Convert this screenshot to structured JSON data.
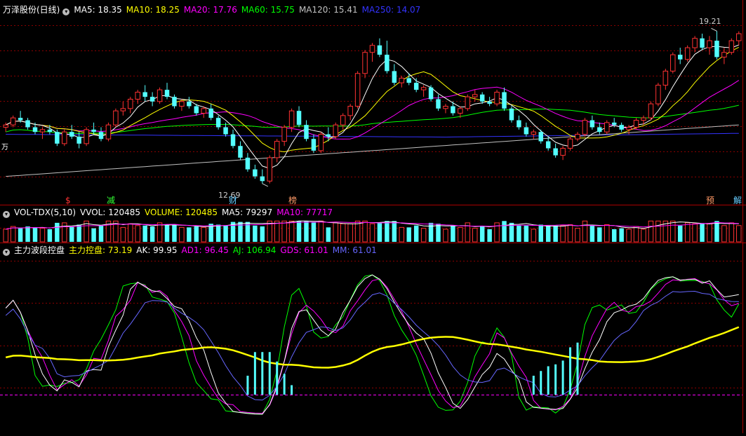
{
  "price_panel": {
    "title": "万泽股份(日线)",
    "ma5": "MA5: 18.35",
    "ma10": "MA10: 18.25",
    "ma20": "MA20: 17.76",
    "ma60": "MA60: 15.75",
    "ma120": "MA120: 15.41",
    "ma250": "MA250: 14.07",
    "high_label": "19.21",
    "low_label": "12.69",
    "left_marker": "万",
    "events": [
      {
        "label": "$",
        "color": "#ff3333"
      },
      {
        "label": "减",
        "color": "#33ff33"
      },
      {
        "label": "财",
        "color": "#66ccff"
      },
      {
        "label": "榜",
        "color": "#ff9966"
      },
      {
        "label": "预",
        "color": "#ff9966"
      },
      {
        "label": "解",
        "color": "#66ccff"
      }
    ]
  },
  "volume_panel": {
    "title": "VOL-TDX(5,10)",
    "vvol": "VVOL: 120485",
    "volume": "VOLUME: 120485",
    "ma5": "MA5: 79297",
    "ma10": "MA10: 77717"
  },
  "indicator_panel": {
    "title": "主力波段控盘",
    "main_label": "主力控盘: 73.19",
    "ak": "AK: 99.95",
    "ad1": "AD1: 96.45",
    "aj": "AJ: 106.94",
    "gds": "GDS: 61.01",
    "mm": "MM: 61.01"
  },
  "colors": {
    "up": "#ff3232",
    "down": "#54ffff",
    "ma5": "#ffffff",
    "ma10": "#ffff00",
    "ma20": "#ff00ff",
    "ma60": "#00ff00",
    "ma120": "#c0c0c0",
    "ma250": "#3333ff",
    "grid": "#8b0000"
  },
  "chart_data": {
    "type": "candlestick",
    "price_range": [
      12.0,
      20.0
    ],
    "candles": [
      [
        15.1,
        15.3,
        14.9,
        15.2
      ],
      [
        15.2,
        15.6,
        15.1,
        15.5
      ],
      [
        15.5,
        15.8,
        15.3,
        15.4
      ],
      [
        15.4,
        15.5,
        15.0,
        15.1
      ],
      [
        15.1,
        15.3,
        14.8,
        14.9
      ],
      [
        14.9,
        15.1,
        14.6,
        15.0
      ],
      [
        15.0,
        15.2,
        14.8,
        14.9
      ],
      [
        14.9,
        15.0,
        14.3,
        14.4
      ],
      [
        14.4,
        15.0,
        14.3,
        14.9
      ],
      [
        14.9,
        15.2,
        14.6,
        14.7
      ],
      [
        14.7,
        14.9,
        14.2,
        14.4
      ],
      [
        14.4,
        15.1,
        14.3,
        15.0
      ],
      [
        15.0,
        15.3,
        14.8,
        14.9
      ],
      [
        14.9,
        15.1,
        14.5,
        14.6
      ],
      [
        14.6,
        15.3,
        14.5,
        15.2
      ],
      [
        15.2,
        15.9,
        15.1,
        15.8
      ],
      [
        15.8,
        16.2,
        15.6,
        15.9
      ],
      [
        15.9,
        16.4,
        15.7,
        16.3
      ],
      [
        16.3,
        16.7,
        16.1,
        16.6
      ],
      [
        16.6,
        16.9,
        16.2,
        16.4
      ],
      [
        16.4,
        16.6,
        16.0,
        16.2
      ],
      [
        16.2,
        16.8,
        16.1,
        16.7
      ],
      [
        16.7,
        17.0,
        16.3,
        16.4
      ],
      [
        16.4,
        16.5,
        15.9,
        16.0
      ],
      [
        16.0,
        16.3,
        15.8,
        16.2
      ],
      [
        16.2,
        16.4,
        15.9,
        16.0
      ],
      [
        16.0,
        16.1,
        15.6,
        15.7
      ],
      [
        15.7,
        16.0,
        15.5,
        15.9
      ],
      [
        15.9,
        16.1,
        15.4,
        15.5
      ],
      [
        15.5,
        15.6,
        15.0,
        15.1
      ],
      [
        15.1,
        15.3,
        14.7,
        14.8
      ],
      [
        14.8,
        15.0,
        14.2,
        14.3
      ],
      [
        14.3,
        14.5,
        13.7,
        13.8
      ],
      [
        13.8,
        14.0,
        13.2,
        13.3
      ],
      [
        13.3,
        13.5,
        12.9,
        13.0
      ],
      [
        13.0,
        13.3,
        12.69,
        12.8
      ],
      [
        12.8,
        13.9,
        12.7,
        13.8
      ],
      [
        13.8,
        14.6,
        13.6,
        14.5
      ],
      [
        14.5,
        15.2,
        14.3,
        15.1
      ],
      [
        15.1,
        15.9,
        14.9,
        15.8
      ],
      [
        15.8,
        16.0,
        15.1,
        15.2
      ],
      [
        15.2,
        15.4,
        14.5,
        14.6
      ],
      [
        14.6,
        14.8,
        14.0,
        14.1
      ],
      [
        14.1,
        14.9,
        14.0,
        14.8
      ],
      [
        14.8,
        15.1,
        14.5,
        14.7
      ],
      [
        14.7,
        15.3,
        14.6,
        15.2
      ],
      [
        15.2,
        15.7,
        15.0,
        15.6
      ],
      [
        15.6,
        16.1,
        15.4,
        16.0
      ],
      [
        16.0,
        17.5,
        15.9,
        17.4
      ],
      [
        17.4,
        18.4,
        17.2,
        18.3
      ],
      [
        18.3,
        18.7,
        17.9,
        18.6
      ],
      [
        18.6,
        18.9,
        18.1,
        18.2
      ],
      [
        18.2,
        18.8,
        17.4,
        17.5
      ],
      [
        17.5,
        17.8,
        16.9,
        17.0
      ],
      [
        17.0,
        17.3,
        16.8,
        17.2
      ],
      [
        17.2,
        17.4,
        16.9,
        17.0
      ],
      [
        17.0,
        17.2,
        16.6,
        16.7
      ],
      [
        16.7,
        16.9,
        16.4,
        16.8
      ],
      [
        16.8,
        16.9,
        16.2,
        16.3
      ],
      [
        16.3,
        16.5,
        15.8,
        15.9
      ],
      [
        15.9,
        16.1,
        15.7,
        16.0
      ],
      [
        16.0,
        16.2,
        15.6,
        15.7
      ],
      [
        15.7,
        16.0,
        15.5,
        15.9
      ],
      [
        15.9,
        16.5,
        15.8,
        16.4
      ],
      [
        16.4,
        16.7,
        16.2,
        16.5
      ],
      [
        16.5,
        16.6,
        16.1,
        16.2
      ],
      [
        16.2,
        16.4,
        16.0,
        16.1
      ],
      [
        16.1,
        16.7,
        16.0,
        16.6
      ],
      [
        16.6,
        16.8,
        15.8,
        15.9
      ],
      [
        15.9,
        16.0,
        15.3,
        15.4
      ],
      [
        15.4,
        15.6,
        15.0,
        15.1
      ],
      [
        15.1,
        15.3,
        14.7,
        14.8
      ],
      [
        14.8,
        15.0,
        14.6,
        14.9
      ],
      [
        14.9,
        15.0,
        14.4,
        14.5
      ],
      [
        14.5,
        14.7,
        14.1,
        14.2
      ],
      [
        14.2,
        14.4,
        13.8,
        13.9
      ],
      [
        13.9,
        14.3,
        13.7,
        14.2
      ],
      [
        14.2,
        14.7,
        14.1,
        14.6
      ],
      [
        14.6,
        14.9,
        14.5,
        14.8
      ],
      [
        14.8,
        15.5,
        14.7,
        15.4
      ],
      [
        15.4,
        15.6,
        15.0,
        15.1
      ],
      [
        15.1,
        15.3,
        14.8,
        14.9
      ],
      [
        14.9,
        15.4,
        14.8,
        15.3
      ],
      [
        15.3,
        15.5,
        15.1,
        15.2
      ],
      [
        15.2,
        15.3,
        14.9,
        15.0
      ],
      [
        15.0,
        15.2,
        14.8,
        15.1
      ],
      [
        15.1,
        15.5,
        15.0,
        15.4
      ],
      [
        15.4,
        15.6,
        15.2,
        15.5
      ],
      [
        15.5,
        16.2,
        15.4,
        16.1
      ],
      [
        16.1,
        17.0,
        16.0,
        16.9
      ],
      [
        16.9,
        17.6,
        16.7,
        17.5
      ],
      [
        17.5,
        18.3,
        17.4,
        18.2
      ],
      [
        18.2,
        18.5,
        17.8,
        18.0
      ],
      [
        18.0,
        18.6,
        17.9,
        18.5
      ],
      [
        18.5,
        19.0,
        18.3,
        18.9
      ],
      [
        18.9,
        19.1,
        18.4,
        18.5
      ],
      [
        18.5,
        19.0,
        18.2,
        18.8
      ],
      [
        18.8,
        19.21,
        18.0,
        18.1
      ],
      [
        18.1,
        18.5,
        17.8,
        18.3
      ],
      [
        18.3,
        18.9,
        18.2,
        18.8
      ],
      [
        18.8,
        19.2,
        18.6,
        19.1
      ]
    ]
  }
}
